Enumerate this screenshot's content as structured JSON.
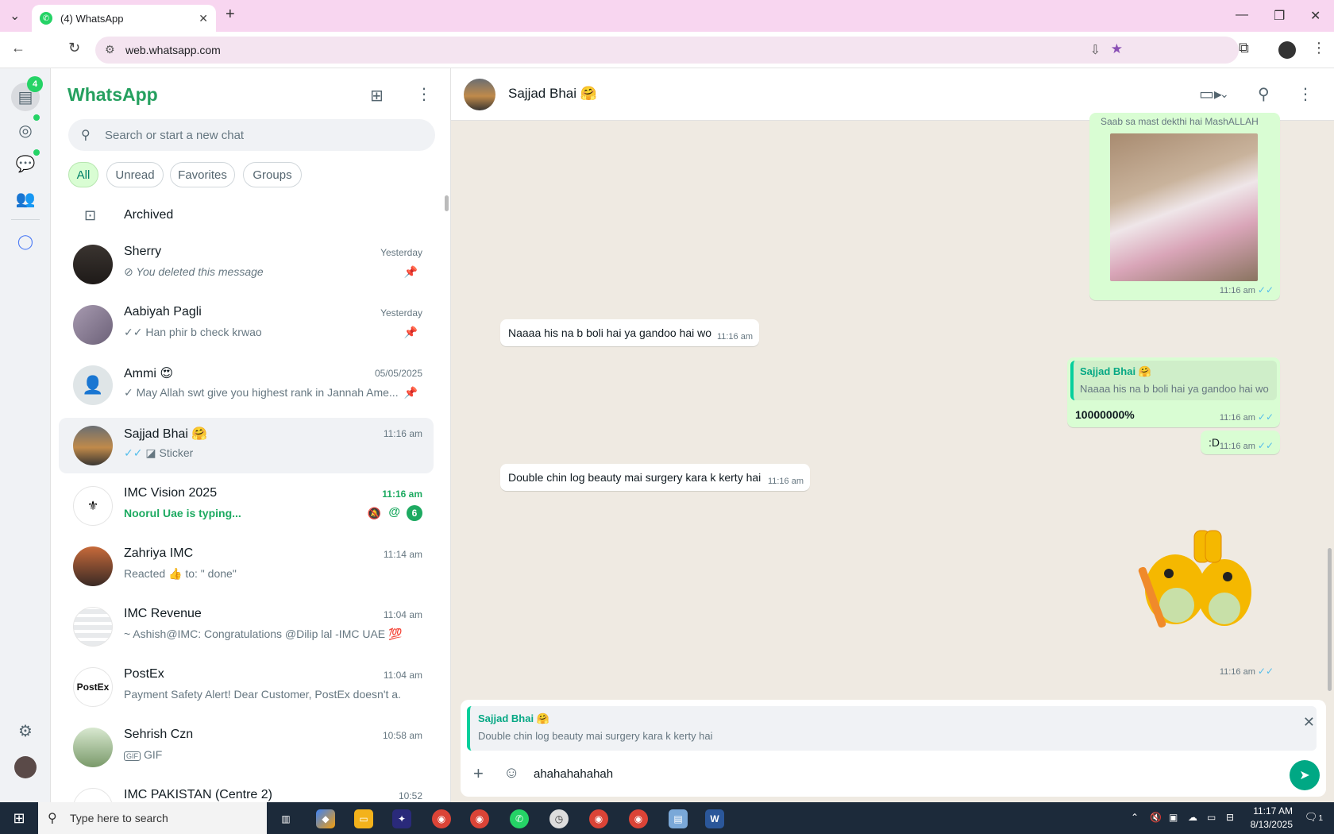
{
  "browser": {
    "tab_title": "(4) WhatsApp",
    "new_tab": "+",
    "url": "web.whatsapp.com"
  },
  "rail": {
    "chats_badge": "4"
  },
  "sidebar": {
    "brand": "WhatsApp",
    "search_placeholder": "Search or start a new chat",
    "filters": [
      "All",
      "Unread",
      "Favorites",
      "Groups"
    ],
    "archived": "Archived",
    "chats": [
      {
        "name": "Sherry",
        "time": "Yesterday",
        "preview": "You deleted this message",
        "pinned": true
      },
      {
        "name": "Aabiyah Pagli",
        "time": "Yesterday",
        "preview": "Han phir b check krwao",
        "pinned": true
      },
      {
        "name": "Ammi 😍",
        "time": "05/05/2025",
        "preview": "May Allah swt give you highest rank in Jannah  Ame...",
        "pinned": true
      },
      {
        "name": "Sajjad Bhai 🤗",
        "time": "11:16 am",
        "preview": "Sticker",
        "selected": true
      },
      {
        "name": "IMC Vision 2025",
        "time": "11:16 am",
        "preview": "Noorul Uae is typing...",
        "unread": "6"
      },
      {
        "name": "Zahriya IMC",
        "time": "11:14 am",
        "preview": "Reacted 👍 to: \" done\""
      },
      {
        "name": "IMC Revenue",
        "time": "11:04 am",
        "preview": "~ Ashish@IMC: Congratulations @Dilip lal -IMC UAE 💯"
      },
      {
        "name": "PostEx",
        "time": "11:04 am",
        "preview": "Payment Safety Alert!   Dear Customer,    PostEx doesn't a..."
      },
      {
        "name": "Sehrish Czn",
        "time": "10:58 am",
        "preview": "GIF"
      },
      {
        "name": "IMC PAKISTAN (Centre 2)",
        "time": "10:52",
        "preview": ""
      }
    ],
    "postex_logo": "PostEx",
    "gif_label": "GIF"
  },
  "chat": {
    "contact": "Sajjad Bhai 🤗",
    "messages": [
      {
        "dir": "out",
        "type": "image",
        "caption_top": "Saab sa mast dekthi hai MashALLAH",
        "time": "11:16 am"
      },
      {
        "dir": "in",
        "text": "Naaaa his na b boli hai ya gandoo hai wo",
        "time": "11:16 am"
      },
      {
        "dir": "out",
        "quote_name": "Sajjad Bhai 🤗",
        "quote_text": "Naaaa his na b boli hai ya gandoo hai wo",
        "text": "10000000%",
        "time": "11:16 am"
      },
      {
        "dir": "out",
        "text": ":D",
        "time": "11:16 am"
      },
      {
        "dir": "in",
        "text": "Double chin log beauty mai surgery kara k kerty hai",
        "time": "11:16 am"
      },
      {
        "dir": "out",
        "type": "sticker",
        "time": "11:16 am"
      }
    ],
    "reply": {
      "name": "Sajjad Bhai 🤗",
      "text": "Double chin log beauty mai surgery kara k kerty hai"
    },
    "composer_value": "ahahahahahah"
  },
  "taskbar": {
    "search_placeholder": "Type here to search",
    "time": "11:17 AM",
    "date": "8/13/2025",
    "notif_count": "1"
  },
  "colors": {
    "accent": "#25d366",
    "bubble_out": "#d9fdd3",
    "chat_bg": "#efeae2",
    "read_tick": "#53bdeb"
  }
}
